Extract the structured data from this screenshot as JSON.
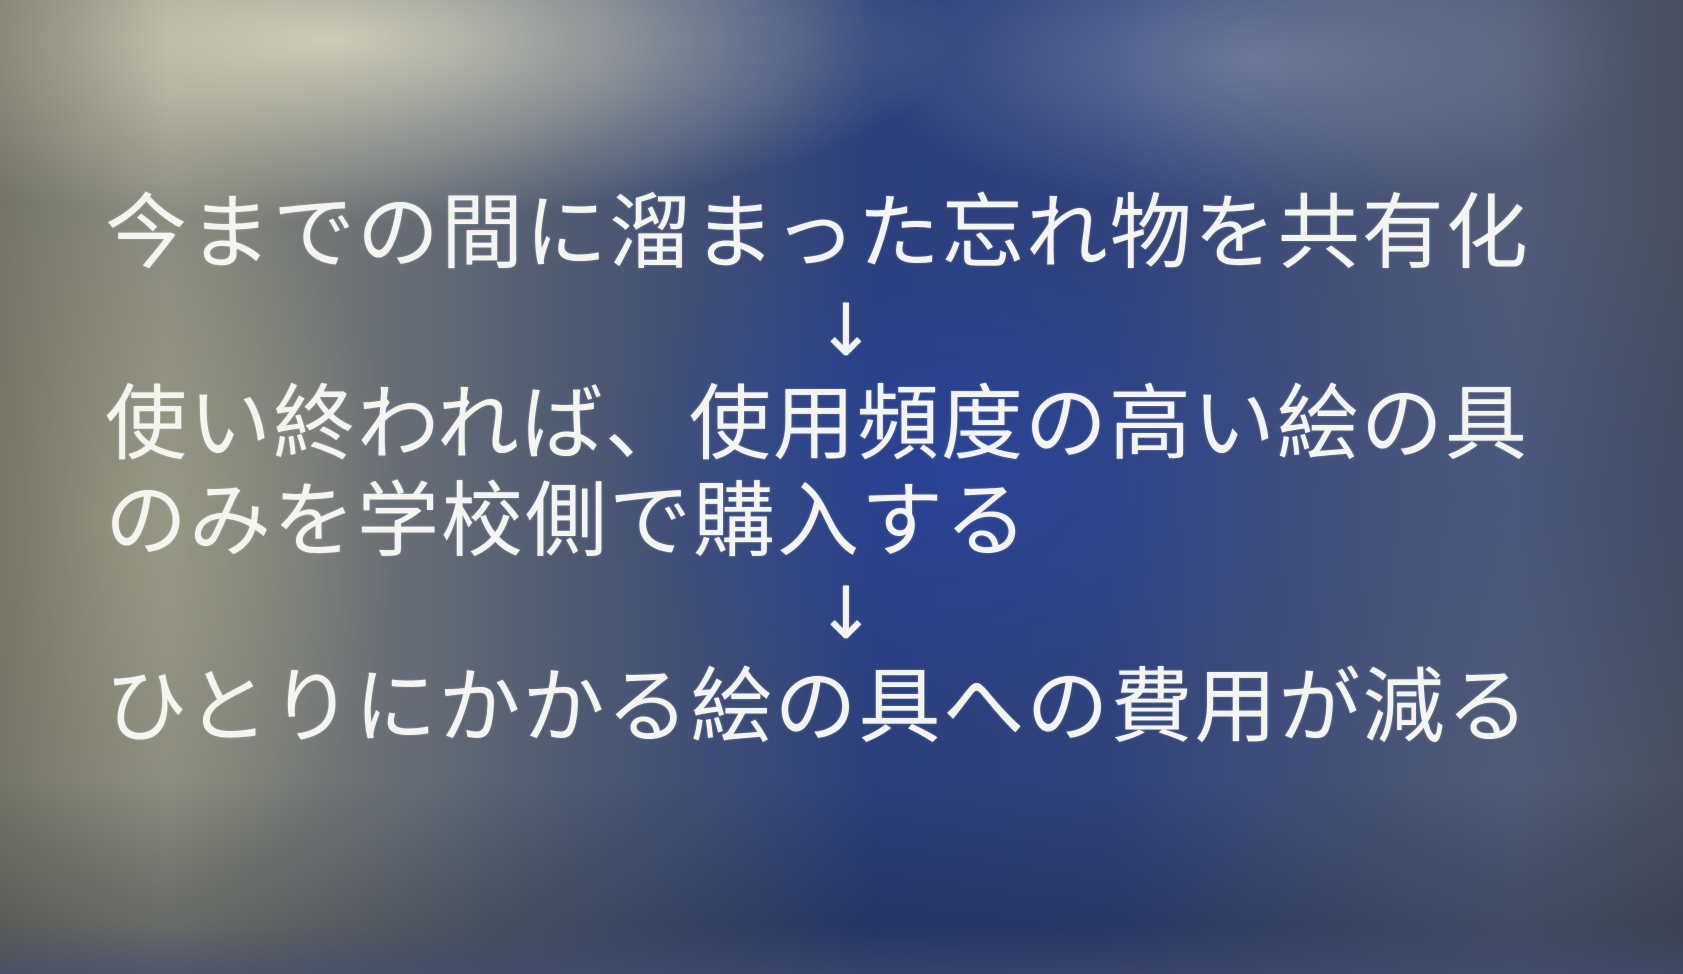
{
  "slide": {
    "lines": [
      "今までの間に溜まった忘れ物を共有化",
      "使い終われば、使用頻度の高い絵の具",
      "のみを学校側で購入する",
      "ひとりにかかる絵の具への費用が減る"
    ],
    "arrows": [
      "↓",
      "↓"
    ]
  },
  "colors": {
    "text": "#f4f4f0",
    "slide_background": "#2b3f7c"
  }
}
